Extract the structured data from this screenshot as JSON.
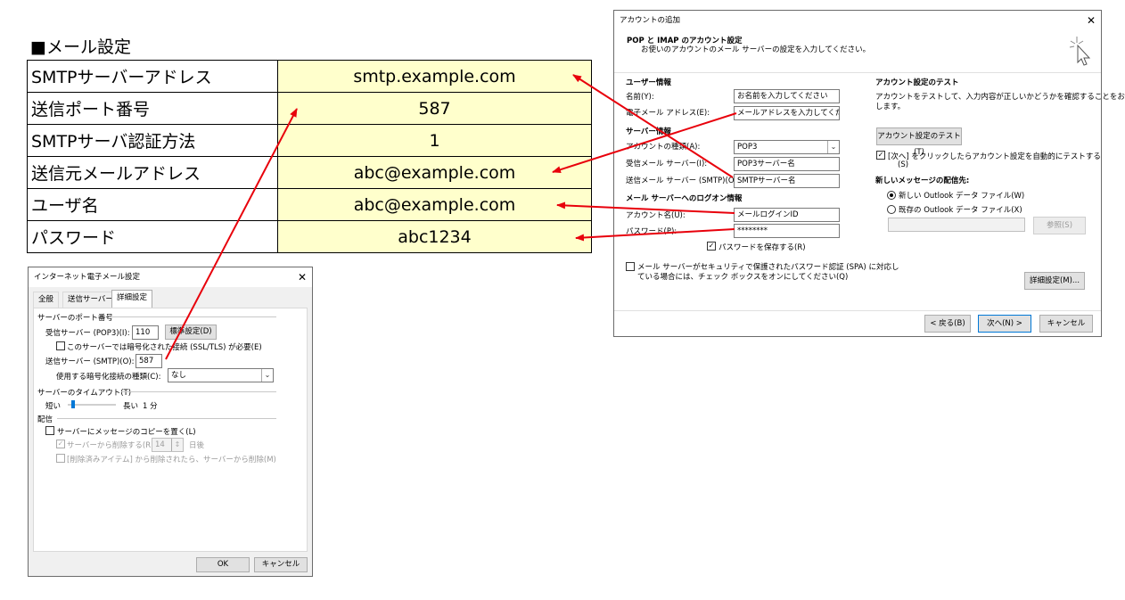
{
  "sheet": {
    "title": "■メール設定",
    "rows": [
      {
        "key": "SMTPサーバーアドレス",
        "value": "smtp.example.com"
      },
      {
        "key": "送信ポート番号",
        "value": "587"
      },
      {
        "key": "SMTPサーバ認証方法",
        "value": "1"
      },
      {
        "key": "送信元メールアドレス",
        "value": "abc@example.com"
      },
      {
        "key": "ユーザ名",
        "value": "abc@example.com"
      },
      {
        "key": "パスワード",
        "value": "abc1234"
      }
    ]
  },
  "account_dialog": {
    "title": "アカウントの追加",
    "close_glyph": "✕",
    "header_title": "POP と IMAP のアカウント設定",
    "header_subtitle": "お使いのアカウントのメール サーバーの設定を入力してください。",
    "user_section": "ユーザー情報",
    "name_label": "名前(Y):",
    "name_value": "お名前を入力してください",
    "email_label": "電子メール アドレス(E):",
    "email_value": "メールアドレスを入力してください",
    "server_section": "サーバー情報",
    "account_type_label": "アカウントの種類(A):",
    "account_type_value": "POP3",
    "incoming_label": "受信メール サーバー(I):",
    "incoming_value": "POP3サーバー名",
    "outgoing_label": "送信メール サーバー (SMTP)(O):",
    "outgoing_value": "SMTPサーバー名",
    "logon_section": "メール サーバーへのログオン情報",
    "account_name_label": "アカウント名(U):",
    "account_name_value": "メールログインID",
    "password_label": "パスワード(P):",
    "password_value": "********",
    "save_password_label": "パスワードを保存する(R)",
    "spa_label_1": "メール サーバーがセキュリティで保護されたパスワード認証 (SPA) に対応し",
    "spa_label_2": "ている場合には、チェック ボックスをオンにしてください(Q)",
    "test_section": "アカウント設定のテスト",
    "test_desc_1": "アカウントをテストして、入力内容が正しいかどうかを確認することをお勧め",
    "test_desc_2": "します。",
    "test_button": "アカウント設定のテスト(T)",
    "auto_test_label_1": "[次へ] をクリックしたらアカウント設定を自動的にテストする",
    "auto_test_label_2": "(S)",
    "delivery_section": "新しいメッセージの配信先:",
    "new_datafile_label": "新しい Outlook データ ファイル(W)",
    "existing_datafile_label": "既存の Outlook データ ファイル(X)",
    "browse_button": "参照(S)",
    "more_settings_button": "詳細設定(M)...",
    "back_button": "< 戻る(B)",
    "next_button": "次へ(N) >",
    "cancel_button": "キャンセル"
  },
  "mail_dialog": {
    "title": "インターネット電子メール設定",
    "close_glyph": "✕",
    "tabs": [
      "全般",
      "送信サーバー",
      "詳細設定"
    ],
    "port_section": "サーバーのポート番号",
    "pop3_label": "受信サーバー (POP3)(I):",
    "pop3_value": "110",
    "default_button": "標準設定(D)",
    "ssl_label": "このサーバーでは暗号化された接続 (SSL/TLS) が必要(E)",
    "smtp_label": "送信サーバー (SMTP)(O):",
    "smtp_value": "587",
    "encryption_label": "使用する暗号化接続の種類(C):",
    "encryption_value": "なし",
    "timeout_section": "サーバーのタイムアウト(T)",
    "timeout_short": "短い",
    "timeout_long": "長い",
    "timeout_value": "1 分",
    "delivery_section": "配信",
    "leave_copy_label": "サーバーにメッセージのコピーを置く(L)",
    "remove_after_label": "サーバーから削除する(R)",
    "remove_after_days": "14",
    "days_unit": "日後",
    "remove_deleted_label": "[削除済みアイテム] から削除されたら、サーバーから削除(M)",
    "ok_button": "OK",
    "cancel_button": "キャンセル"
  },
  "colors": {
    "value_cell": "#ffffcc",
    "arrow": "#e8000b"
  }
}
